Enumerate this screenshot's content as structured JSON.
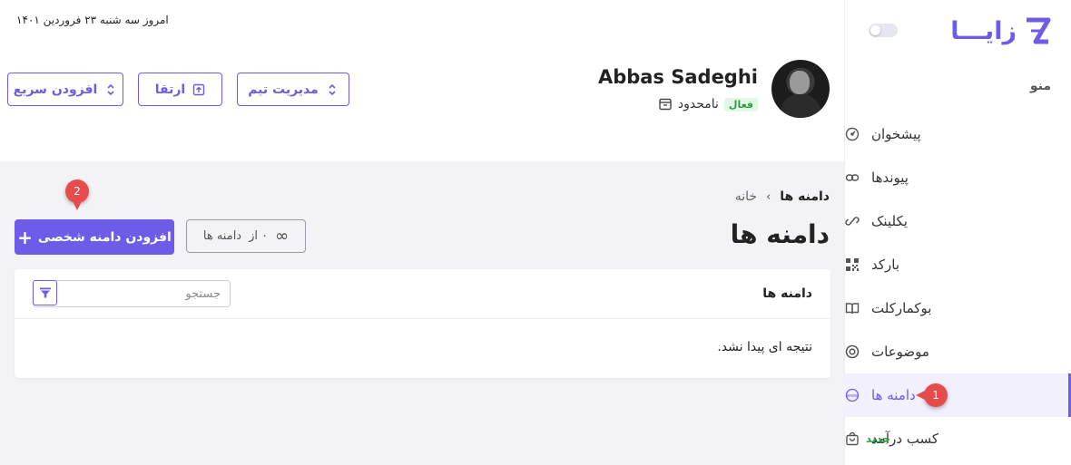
{
  "header": {
    "date_text": "امروز سه شنبه ۲۳ فروردین ۱۴۰۱",
    "profile": {
      "name": "Abbas Sadeghi",
      "plan_label": "نامحدود",
      "status_badge": "فعال"
    },
    "buttons": {
      "team_manage": "مدیریت تیم",
      "upgrade": "ارتقا",
      "quick_add": "افزودن سریع"
    }
  },
  "sidebar": {
    "brand": "زایـــا",
    "menu_title": "منو",
    "items": [
      {
        "label": "پیشخوان",
        "icon": "dashboard-icon"
      },
      {
        "label": "پیوندها",
        "icon": "link-icon"
      },
      {
        "label": "یکلینک",
        "icon": "chain-link-icon"
      },
      {
        "label": "بارکد",
        "icon": "qr-code-icon"
      },
      {
        "label": "بوکمارکلت",
        "icon": "book-icon"
      },
      {
        "label": "موضوعات",
        "icon": "target-icon"
      },
      {
        "label": "دامنه ها",
        "icon": "www-icon",
        "active": true
      },
      {
        "label": "کسب درآمد",
        "icon": "shopping-bag-icon",
        "badge": "جدید"
      }
    ]
  },
  "main": {
    "breadcrumb": {
      "home": "خانه",
      "separator": "›",
      "current": "دامنه ها"
    },
    "page_title": "دامنه ها",
    "counter": {
      "prefix": "دامنه ها",
      "value": "۰ از",
      "limit": "∞"
    },
    "add_button": "افزودن دامنه شخصی",
    "table": {
      "title": "دامنه ها",
      "search_placeholder": "جستجو",
      "empty_message": "نتیجه ای پیدا نشد."
    }
  },
  "annotations": {
    "marker_1": "1",
    "marker_2": "2"
  },
  "colors": {
    "accent": "#6c5ce7",
    "success": "#2e9d44",
    "marker": "#e74c4c"
  }
}
